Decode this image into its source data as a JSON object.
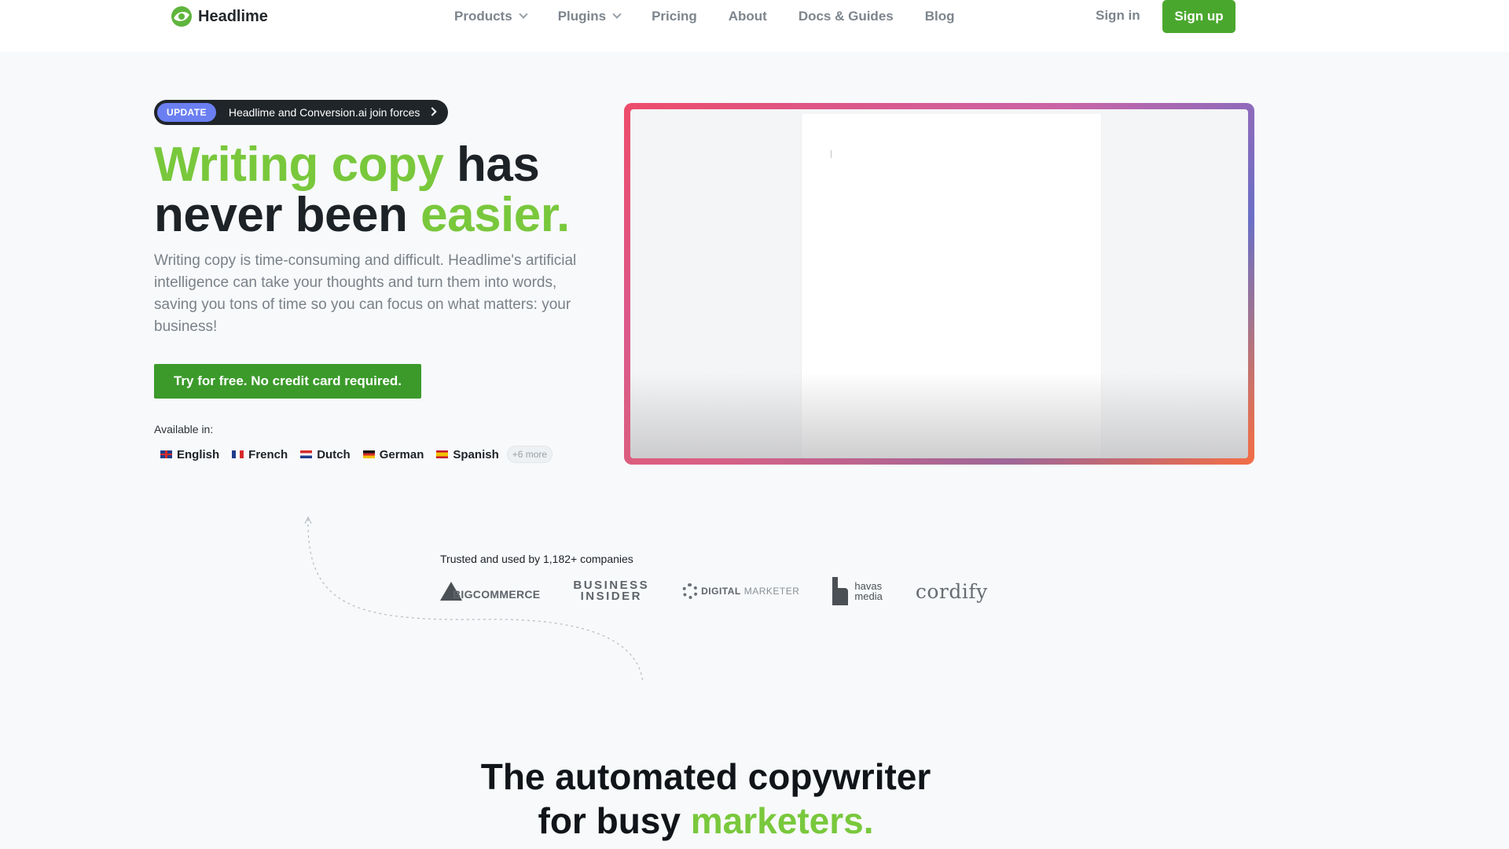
{
  "nav": {
    "brand": "Headlime",
    "links": [
      {
        "label": "Products",
        "dropdown": true
      },
      {
        "label": "Plugins",
        "dropdown": true
      },
      {
        "label": "Pricing",
        "dropdown": false
      },
      {
        "label": "About",
        "dropdown": false
      },
      {
        "label": "Docs & Guides",
        "dropdown": false
      },
      {
        "label": "Blog",
        "dropdown": false
      }
    ],
    "signin": "Sign in",
    "signup": "Sign up"
  },
  "hero": {
    "update_badge": "UPDATE",
    "update_text": "Headlime and Conversion.ai join forces",
    "title_part1": "Writing copy",
    "title_part2": " has",
    "title_part3": "never been ",
    "title_part4": "easier.",
    "description": "Writing copy is time-consuming and difficult. Headlime's artificial intelligence can take your thoughts and turn them into words, saving you tons of time so you can focus on what matters: your business!",
    "cta": "Try for free. No credit card required.",
    "available_label": "Available in:",
    "languages": [
      "English",
      "French",
      "Dutch",
      "German",
      "Spanish"
    ],
    "more_languages": "+6 more"
  },
  "trusted": {
    "text": "Trusted and used by 1,182+ companies",
    "logos": {
      "bigcommerce": "BIGCOMMERCE",
      "business_insider_1": "BUSINESS",
      "business_insider_2": "INSIDER",
      "digital_marketer_1": "DIGITAL",
      "digital_marketer_2": "MARKETER",
      "havas_1": "havas",
      "havas_2": "media",
      "cordify": "cordify"
    }
  },
  "section2": {
    "title_line1": "The automated copywriter",
    "title_line2_part1": "for busy ",
    "title_line2_part2": "marketers."
  },
  "colors": {
    "brand_green": "#4aa72d",
    "accent_green": "#79c83c",
    "update_badge": "#6a7ff2",
    "text_dark": "#1d2227",
    "text_muted": "#7a8188"
  }
}
